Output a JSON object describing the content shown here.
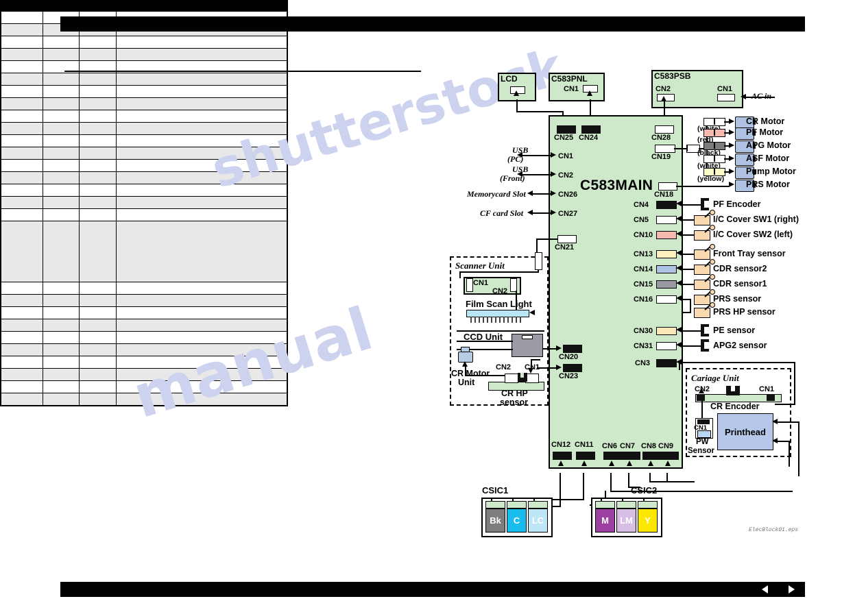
{
  "page": {
    "eps_filename": "ElecBlock01.eps",
    "watermark_line1": "shutterstock",
    "watermark_line2": "manual",
    "footer_prev_icon": "triangle-left-icon",
    "footer_next_icon": "triangle-right-icon"
  },
  "spec_table": {
    "column_headers": [
      "",
      "",
      "",
      ""
    ],
    "rows": [
      {
        "shaded": false,
        "cells": [
          "",
          "",
          "",
          ""
        ],
        "height": 17
      },
      {
        "shaded": true,
        "cells": [
          "",
          "",
          "",
          ""
        ],
        "height": 17
      },
      {
        "shaded": false,
        "cells": [
          "",
          "",
          "",
          ""
        ],
        "height": 17
      },
      {
        "shaded": true,
        "cells": [
          "",
          "",
          "",
          ""
        ],
        "height": 17
      },
      {
        "shaded": false,
        "cells": [
          "",
          "",
          "",
          ""
        ],
        "height": 17
      },
      {
        "shaded": true,
        "cells": [
          "",
          "",
          "",
          ""
        ],
        "height": 17
      },
      {
        "shaded": false,
        "cells": [
          "",
          "",
          "",
          ""
        ],
        "height": 17
      },
      {
        "shaded": true,
        "cells": [
          "",
          "",
          "",
          ""
        ],
        "height": 17
      },
      {
        "shaded": false,
        "cells": [
          "",
          "",
          "",
          ""
        ],
        "height": 17
      },
      {
        "shaded": true,
        "cells": [
          "",
          "",
          "",
          ""
        ],
        "height": 17
      },
      {
        "shaded": false,
        "cells": [
          "",
          "",
          "",
          ""
        ],
        "height": 17
      },
      {
        "shaded": true,
        "cells": [
          "",
          "",
          "",
          ""
        ],
        "height": 17
      },
      {
        "shaded": false,
        "cells": [
          "",
          "",
          "",
          ""
        ],
        "height": 17
      },
      {
        "shaded": true,
        "cells": [
          "",
          "",
          "",
          ""
        ],
        "height": 17
      },
      {
        "shaded": false,
        "cells": [
          "",
          "",
          "",
          ""
        ],
        "height": 17
      },
      {
        "shaded": true,
        "cells": [
          "",
          "",
          "",
          ""
        ],
        "height": 17
      },
      {
        "shaded": false,
        "cells": [
          "",
          "",
          "",
          ""
        ],
        "height": 17
      },
      {
        "shaded": true,
        "cells": [
          "",
          "",
          "",
          ""
        ],
        "height": 88
      },
      {
        "shaded": false,
        "cells": [
          "",
          "",
          "",
          ""
        ],
        "height": 17
      },
      {
        "shaded": true,
        "cells": [
          "",
          "",
          "",
          ""
        ],
        "height": 17
      },
      {
        "shaded": false,
        "cells": [
          "",
          "",
          "",
          ""
        ],
        "height": 17
      },
      {
        "shaded": true,
        "cells": [
          "",
          "",
          "",
          ""
        ],
        "height": 17
      },
      {
        "shaded": false,
        "cells": [
          "",
          "",
          "",
          ""
        ],
        "height": 17
      },
      {
        "shaded": true,
        "cells": [
          "",
          "",
          "",
          ""
        ],
        "height": 17
      },
      {
        "shaded": false,
        "cells": [
          "",
          "",
          "",
          ""
        ],
        "height": 17
      },
      {
        "shaded": true,
        "cells": [
          "",
          "",
          "",
          ""
        ],
        "height": 17
      },
      {
        "shaded": false,
        "cells": [
          "",
          "",
          "",
          ""
        ],
        "height": 17
      },
      {
        "shaded": true,
        "cells": [
          "",
          "",
          "",
          ""
        ],
        "height": 17
      }
    ]
  },
  "diagram": {
    "boards": {
      "lcd": {
        "label": "LCD",
        "connector": ""
      },
      "panel": {
        "label": "C583PNL",
        "connector": "CN1"
      },
      "psb": {
        "label": "C583PSB",
        "connector_left": "CN2",
        "connector_right": "CN1",
        "ac_label": "AC in"
      },
      "main": {
        "label": "C583MAIN"
      }
    },
    "main_top_connectors": [
      {
        "id": "CN25",
        "color": "black"
      },
      {
        "id": "CN24",
        "color": "black"
      },
      {
        "id": "CN28",
        "color": "white"
      }
    ],
    "main_left_connectors": [
      {
        "id": "CN1",
        "device": "USB\n(PC)",
        "device_l1": "USB",
        "device_l2": "(PC)"
      },
      {
        "id": "CN2",
        "device": "USB\n(Front)",
        "device_l1": "USB",
        "device_l2": "(Front)"
      },
      {
        "id": "CN26",
        "device": "Memorycard Slot",
        "device_l1": "Memorycard Slot",
        "device_l2": ""
      },
      {
        "id": "CN27",
        "device": "CF card Slot",
        "device_l1": "CF card Slot",
        "device_l2": ""
      }
    ],
    "main_left_lower_connectors": [
      {
        "id": "CN21",
        "color": "white"
      },
      {
        "id": "CN20",
        "color": "black"
      },
      {
        "id": "CN23",
        "color": "black"
      }
    ],
    "main_right_upper_connectors": [
      {
        "id": "CN19",
        "color": "white"
      },
      {
        "id": "CN18",
        "color": "white"
      }
    ],
    "motors": [
      {
        "name": "CR Motor",
        "wire_color_label": "(white)",
        "wire_swatch": "white"
      },
      {
        "name": "PF Motor",
        "wire_color_label": "(red)",
        "wire_swatch": "red"
      },
      {
        "name": "APG Motor",
        "wire_color_label": "(black)",
        "wire_swatch": "darkgray"
      },
      {
        "name": "ASF Motor",
        "wire_color_label": "(white)",
        "wire_swatch": "white"
      },
      {
        "name": "Pump Motor",
        "wire_color_label": "(yellow)",
        "wire_swatch": "yellow"
      },
      {
        "name": "PRS Motor",
        "wire_color_label": "",
        "wire_swatch": ""
      }
    ],
    "sensors": [
      {
        "cn": "CN4",
        "name": "PF Encoder",
        "conn_color": "black",
        "device_type": "photointerrupter"
      },
      {
        "cn": "CN5",
        "name": "I/C Cover SW1 (right)",
        "conn_color": "white",
        "device_type": "switch"
      },
      {
        "cn": "CN10",
        "name": "I/C Cover SW2 (left)",
        "conn_color": "red",
        "device_type": "switch"
      },
      {
        "cn": "CN13",
        "name": "Front Tray sensor",
        "conn_color": "cream",
        "device_type": "switch"
      },
      {
        "cn": "CN14",
        "name": "CDR sensor2",
        "conn_color": "blue",
        "device_type": "switch"
      },
      {
        "cn": "CN15",
        "name": "CDR sensor1",
        "conn_color": "gray",
        "device_type": "switch"
      },
      {
        "cn": "CN16",
        "name": "PRS sensor",
        "conn_color": "white",
        "device_type": "switch"
      },
      {
        "cn": "",
        "name": "PRS HP sensor",
        "conn_color": "",
        "device_type": "switch"
      },
      {
        "cn": "CN30",
        "name": "PE sensor",
        "conn_color": "pale",
        "device_type": "photointerrupter"
      },
      {
        "cn": "CN31",
        "name": "APG2 sensor",
        "conn_color": "white",
        "device_type": "photointerrupter"
      },
      {
        "cn": "CN3",
        "name": "",
        "conn_color": "black",
        "device_type": ""
      }
    ],
    "scanner_unit": {
      "title": "Scanner Unit",
      "board_cn1": "CN1",
      "board_cn2": "CN2",
      "film_scan_light": "Film Scan Light",
      "ccd_unit": "CCD Unit",
      "cr_motor_unit_l1": "CR Motor",
      "cr_motor_unit_l2": "Unit",
      "cr_hp_cn2": "CN2",
      "cr_hp_cn1": "CN1",
      "cr_hp_sensor_l1": "CR HP",
      "cr_hp_sensor_l2": "sensor"
    },
    "carriage_unit": {
      "title": "Cariage Unit",
      "cn2": "CN2",
      "cn1": "CN1",
      "cr_encoder": "CR Encoder",
      "pw_cn1": "CN1",
      "pw_sensor_l1": "PW",
      "pw_sensor_l2": "Sensor",
      "printhead": "Printhead"
    },
    "main_bottom_connectors": [
      "CN12",
      "CN11",
      "CN6",
      "CN7",
      "CN8",
      "CN9"
    ],
    "csic1": {
      "label": "CSIC1",
      "cartridges": [
        {
          "name": "Bk",
          "color": "#7d7d7d",
          "text_color": "#ffffff"
        },
        {
          "name": "C",
          "color": "#18bced",
          "text_color": "#ffffff"
        },
        {
          "name": "LC",
          "color": "#bfe6f7",
          "text_color": "#ffffff"
        }
      ]
    },
    "csic2": {
      "label": "CSIC2",
      "cartridges": [
        {
          "name": "M",
          "color": "#9b3fa0",
          "text_color": "#ffffff"
        },
        {
          "name": "LM",
          "color": "#d8bde4",
          "text_color": "#ffffff"
        },
        {
          "name": "Y",
          "color": "#fbe700",
          "text_color": "#ffffff"
        }
      ]
    },
    "colors": {
      "board_green": "#cde9c9",
      "printhead_blue": "#b6c8ea",
      "motor_blue": "#aec3e3",
      "switch_tan": "#fbd9b0",
      "film_light_blue": "#b9e6f7"
    }
  }
}
